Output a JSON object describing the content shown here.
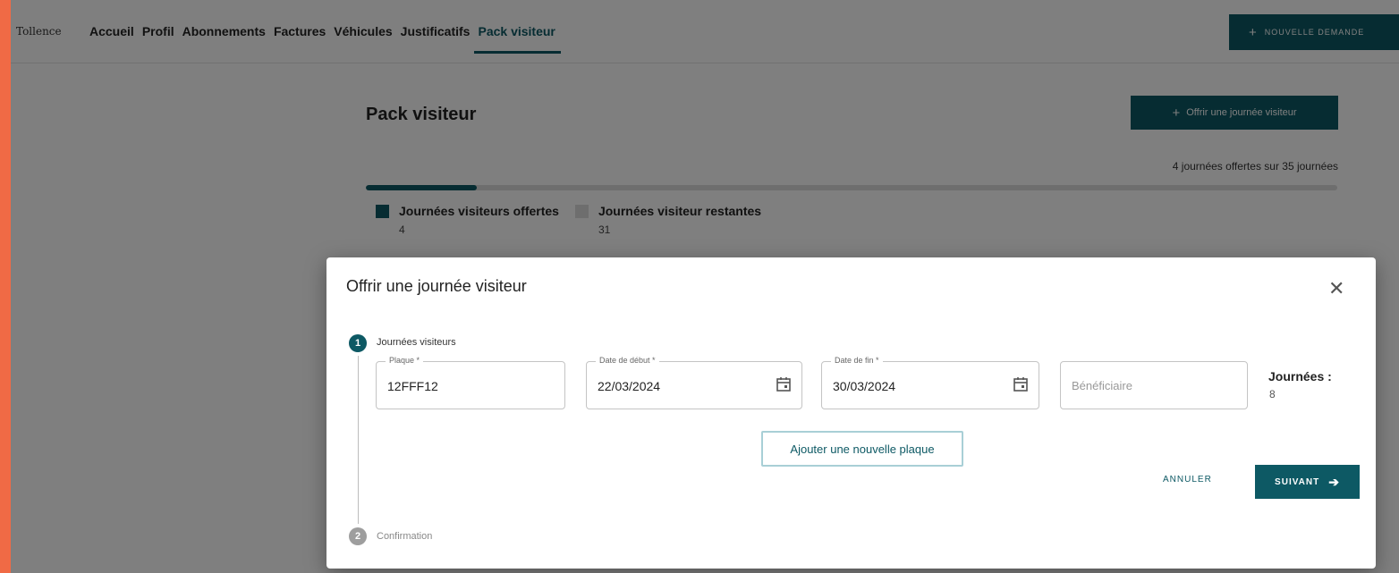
{
  "app": {
    "logo_text": "Tollence"
  },
  "nav": {
    "items": [
      {
        "label": "Accueil"
      },
      {
        "label": "Profil"
      },
      {
        "label": "Abonnements"
      },
      {
        "label": "Factures"
      },
      {
        "label": "Véhicules"
      },
      {
        "label": "Justificatifs"
      },
      {
        "label": "Pack visiteur",
        "active": true
      }
    ],
    "new_request_label": "NOUVELLE DEMANDE"
  },
  "page": {
    "title": "Pack visiteur",
    "offer_button_label": "Offrir une journée visiteur",
    "summary": "4 journées offertes sur 35 journées",
    "progress_fraction": 0.114,
    "legend": [
      {
        "label": "Journées visiteurs offertes",
        "value": "4",
        "color": "#0d5964"
      },
      {
        "label": "Journées visiteur restantes",
        "value": "31",
        "color": "#dcdcdc"
      }
    ]
  },
  "dialog": {
    "title": "Offrir une journée visiteur",
    "steps": [
      {
        "number": "1",
        "label": "Journées visiteurs"
      },
      {
        "number": "2",
        "label": "Confirmation"
      }
    ],
    "fields": {
      "plaque": {
        "label": "Plaque *",
        "value": "12FFF12"
      },
      "start_date": {
        "label": "Date de début *",
        "value": "22/03/2024"
      },
      "end_date": {
        "label": "Date de fin *",
        "value": "30/03/2024"
      },
      "beneficiaire": {
        "placeholder": "Bénéficiaire"
      }
    },
    "days": {
      "label": "Journées :",
      "value": "8"
    },
    "add_plate_label": "Ajouter une nouvelle plaque",
    "cancel_label": "ANNULER",
    "next_label": "SUIVANT"
  },
  "colors": {
    "accent": "#0d5964",
    "background_frame": "#f06a45"
  }
}
